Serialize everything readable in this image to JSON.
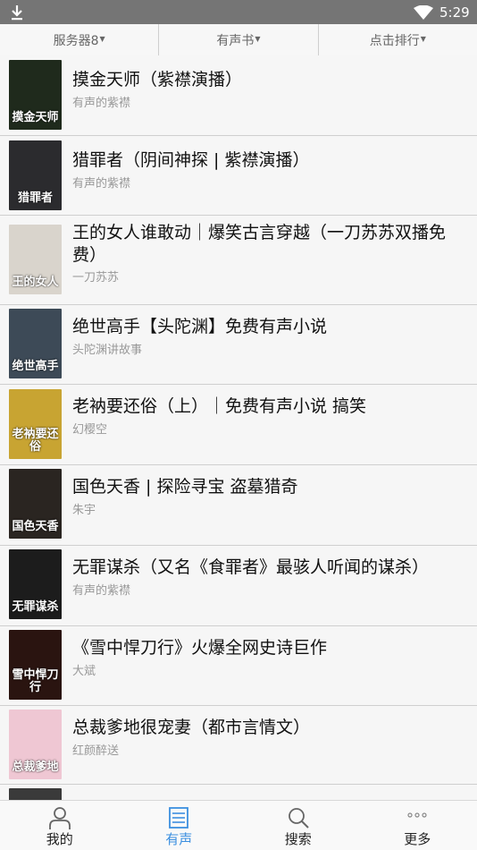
{
  "status_bar": {
    "time": "5:29"
  },
  "filters": [
    {
      "label": "服务器8"
    },
    {
      "label": "有声书"
    },
    {
      "label": "点击排行"
    }
  ],
  "books": [
    {
      "title": "摸金天师（紫襟演播）",
      "author": "有声的紫襟",
      "cover_text": "摸金天师",
      "cover_color": "#1f2a1c"
    },
    {
      "title": "猎罪者（阴间神探 | 紫襟演播）",
      "author": "有声的紫襟",
      "cover_text": "猎罪者",
      "cover_color": "#2b2b2e"
    },
    {
      "title": "王的女人谁敢动｜爆笑古言穿越（一刀苏苏双播免费）",
      "author": "一刀苏苏",
      "cover_text": "王的女人",
      "cover_color": "#d9d4cc"
    },
    {
      "title": "绝世高手【头陀渊】免费有声小说",
      "author": "头陀渊讲故事",
      "cover_text": "绝世高手",
      "cover_color": "#3d4a57"
    },
    {
      "title": "老衲要还俗（上）｜免费有声小说 搞笑",
      "author": "幻樱空",
      "cover_text": "老衲要还俗",
      "cover_color": "#c8a432"
    },
    {
      "title": "国色天香 | 探险寻宝 盗墓猎奇",
      "author": "朱宇",
      "cover_text": "国色天香",
      "cover_color": "#2a2521"
    },
    {
      "title": "无罪谋杀（又名《食罪者》最骇人听闻的谋杀）",
      "author": "有声的紫襟",
      "cover_text": "无罪谋杀",
      "cover_color": "#1c1c1c"
    },
    {
      "title": "《雪中悍刀行》火爆全网史诗巨作",
      "author": "大斌",
      "cover_text": "雪中悍刀行",
      "cover_color": "#2a1410"
    },
    {
      "title": "总裁爹地很宠妻（都市言情文）",
      "author": "红颜醉送",
      "cover_text": "总裁爹地",
      "cover_color": "#efc7d3"
    },
    {
      "title": "",
      "author": "",
      "cover_text": "",
      "cover_color": "#3a3a3a"
    }
  ],
  "tabs": [
    {
      "label": "我的",
      "icon": "person-icon"
    },
    {
      "label": "有声",
      "icon": "list-icon"
    },
    {
      "label": "搜索",
      "icon": "search-icon"
    },
    {
      "label": "更多",
      "icon": "more-icon"
    }
  ],
  "colors": {
    "accent": "#3b8fe0",
    "status_bar": "#757575"
  }
}
